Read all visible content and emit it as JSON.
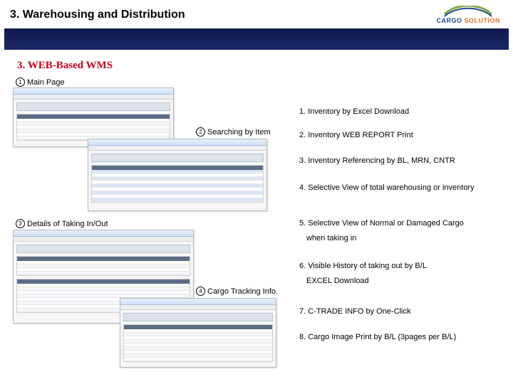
{
  "header": {
    "title": "3. Warehousing and Distribution",
    "logo_brand_a": "CARGO",
    "logo_brand_b": "SOLUTION"
  },
  "subtitle": "3. WEB-Based WMS",
  "captions": {
    "c1": "Main Page",
    "c2": "Searching by Item",
    "c3": "Details of Taking In/Out",
    "c4": "Cargo Tracking Info."
  },
  "features": {
    "f1": "1. Inventory by Excel Download",
    "f2": "2. Inventory WEB REPORT Print",
    "f3": "3. Inventory Referencing by BL, MRN, CNTR",
    "f4": "4. Selective View of total warehousing or inventory",
    "f5": "5. Selective View of Normal or Damaged Cargo",
    "f5b": "when taking in",
    "f6": "6. Visible History of taking out by B/L",
    "f6b": "EXCEL Download",
    "f7": "7. C-TRADE INFO by One-Click",
    "f8": "8. Cargo Image Print by B/L (3pages per B/L)"
  }
}
